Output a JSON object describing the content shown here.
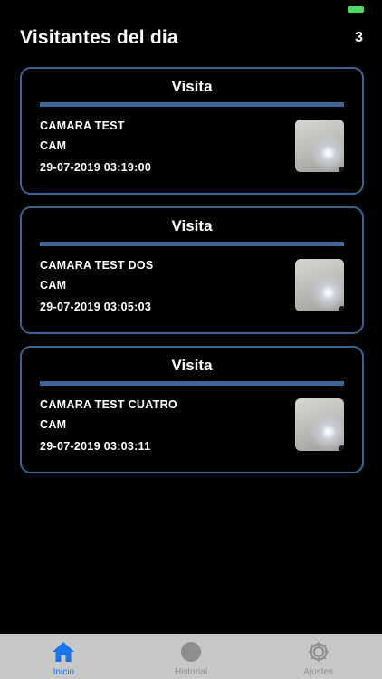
{
  "header": {
    "title": "Visitantes del dia",
    "count": "3"
  },
  "visits": [
    {
      "title": "Visita",
      "camera": "CAMARA TEST",
      "type": "CAM",
      "datetime": "29-07-2019 03:19:00"
    },
    {
      "title": "Visita",
      "camera": "CAMARA TEST DOS",
      "type": "CAM",
      "datetime": "29-07-2019 03:05:03"
    },
    {
      "title": "Visita",
      "camera": "CAMARA TEST CUATRO",
      "type": "CAM",
      "datetime": "29-07-2019 03:03:11"
    }
  ],
  "tabbar": {
    "tabs": [
      {
        "label": "Inicio",
        "icon": "home-icon"
      },
      {
        "label": "Historial",
        "icon": "history-icon"
      },
      {
        "label": "Ajustes",
        "icon": "gear-icon"
      }
    ],
    "active_tab": "Inicio"
  },
  "colors": {
    "background": "#000000",
    "card_border": "#3c6393",
    "accent_blue": "#1a73e8",
    "tabbar_bg": "#c8c8c8",
    "battery": "#4cd964"
  }
}
